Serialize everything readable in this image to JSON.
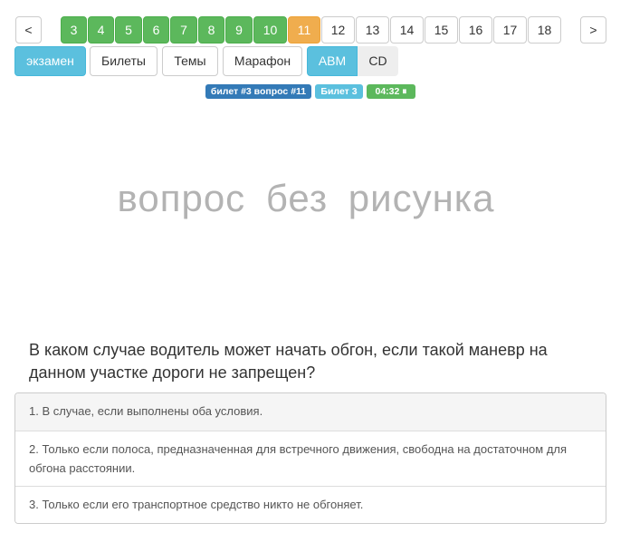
{
  "pagination": {
    "prev": "<",
    "next": ">",
    "pages": [
      "3",
      "4",
      "5",
      "6",
      "7",
      "8",
      "9",
      "10",
      "11",
      "12",
      "13",
      "14",
      "15",
      "16",
      "17",
      "18"
    ],
    "answered": [
      "3",
      "4",
      "5",
      "6",
      "7",
      "8",
      "9",
      "10"
    ],
    "current": "11"
  },
  "modes": {
    "exam": "экзамен",
    "tickets": "Билеты",
    "topics": "Темы",
    "marathon": "Марафон",
    "abm": "ABM",
    "cd": "CD"
  },
  "badges": {
    "ticket_question": "билет #3 вопрос #11",
    "ticket": "Билет 3",
    "timer": "04:32 ⏸"
  },
  "no_image_text": "вопрос без рисунка",
  "question": "В каком случае водитель может начать обгон, если такой маневр на данном участке дороги не запрещен?",
  "answers": [
    "1. В случае, если выполнены оба условия.",
    "2. Только если полоса, предназначенная для встречного движения, свободна на достаточном для обгона расстоянии.",
    "3. Только если его транспортное средство никто не обгоняет."
  ],
  "colors": {
    "answered": "#5cb85c",
    "current": "#f0ad4e",
    "info": "#5bc0de",
    "primary": "#337ab7"
  }
}
